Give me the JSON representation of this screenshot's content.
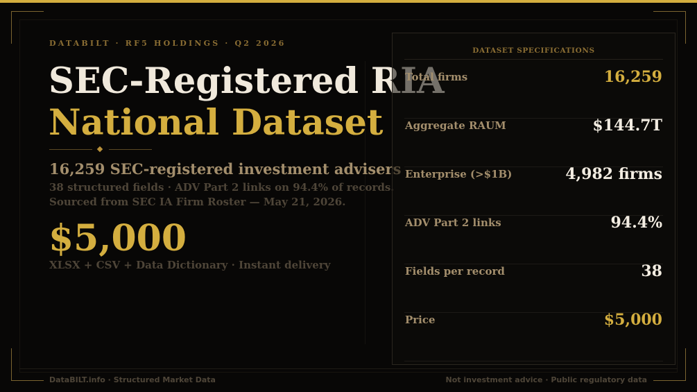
{
  "header": {
    "eyebrow": "DATABILT  ·  RF5 HOLDINGS  ·  Q2 2026"
  },
  "hero": {
    "title_line1": "SEC-Registered RIA",
    "title_line2": "National Dataset",
    "subheadline": "16,259 SEC-registered investment advisers",
    "description_line1": "38 structured fields  ·  ADV Part 2 links on 94.4% of records.",
    "description_line2": "Sourced from SEC IA Firm Roster — May 21, 2026.",
    "price": "$5,000",
    "delivery": "XLSX + CSV + Data Dictionary  ·  Instant delivery"
  },
  "specs": {
    "title": "DATASET SPECIFICATIONS",
    "rows": [
      {
        "label": "Total firms",
        "value": "16,259",
        "accent": "gold"
      },
      {
        "label": "Aggregate RAUM",
        "value": "$144.7T",
        "accent": "white"
      },
      {
        "label": "Enterprise (>$1B)",
        "value": "4,982 firms",
        "accent": "white"
      },
      {
        "label": "ADV Part 2 links",
        "value": "94.4%",
        "accent": "white"
      },
      {
        "label": "Fields per record",
        "value": "38",
        "accent": "white"
      },
      {
        "label": "Price",
        "value": "$5,000",
        "accent": "gold"
      }
    ]
  },
  "footer": {
    "left": "DataBILT.info  ·  Structured Market Data",
    "right": "Not investment advice  ·  Public regulatory data"
  },
  "colors": {
    "background": "#080706",
    "gold": "#d4ae3f",
    "cream": "#f0e9dc",
    "muted": "#a38e6c"
  }
}
